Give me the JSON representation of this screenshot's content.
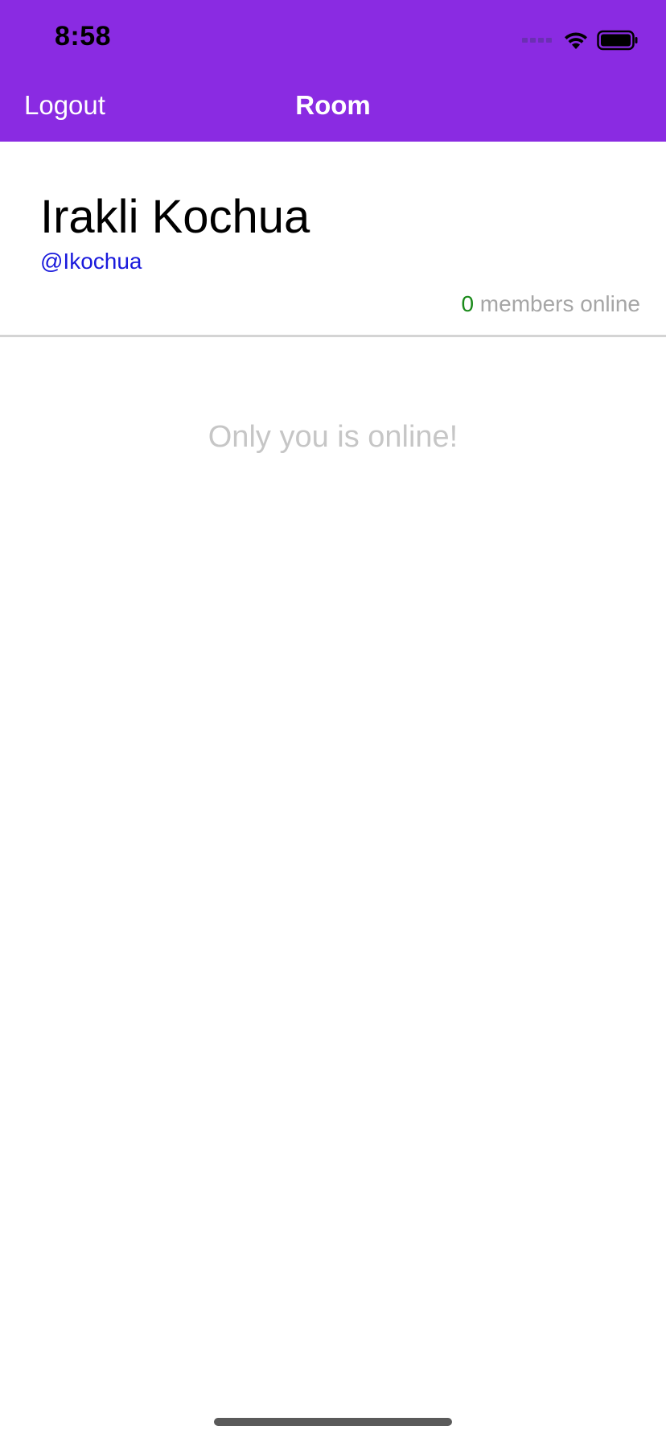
{
  "status_bar": {
    "time": "8:58"
  },
  "nav": {
    "logout_label": "Logout",
    "title": "Room"
  },
  "profile": {
    "name": "Irakli Kochua",
    "handle": "@Ikochua",
    "online_count": "0",
    "online_suffix": " members online"
  },
  "members": {
    "empty_message": "Only you is online!"
  },
  "colors": {
    "header_bg": "#8a2be2",
    "handle": "#1a1adc",
    "online_count": "#1a8a1a",
    "muted_text": "#a6a6a6",
    "empty_text": "#c6c6c6"
  },
  "icons": {
    "status": [
      "cellular-signal-icon",
      "wifi-icon",
      "battery-icon"
    ]
  }
}
